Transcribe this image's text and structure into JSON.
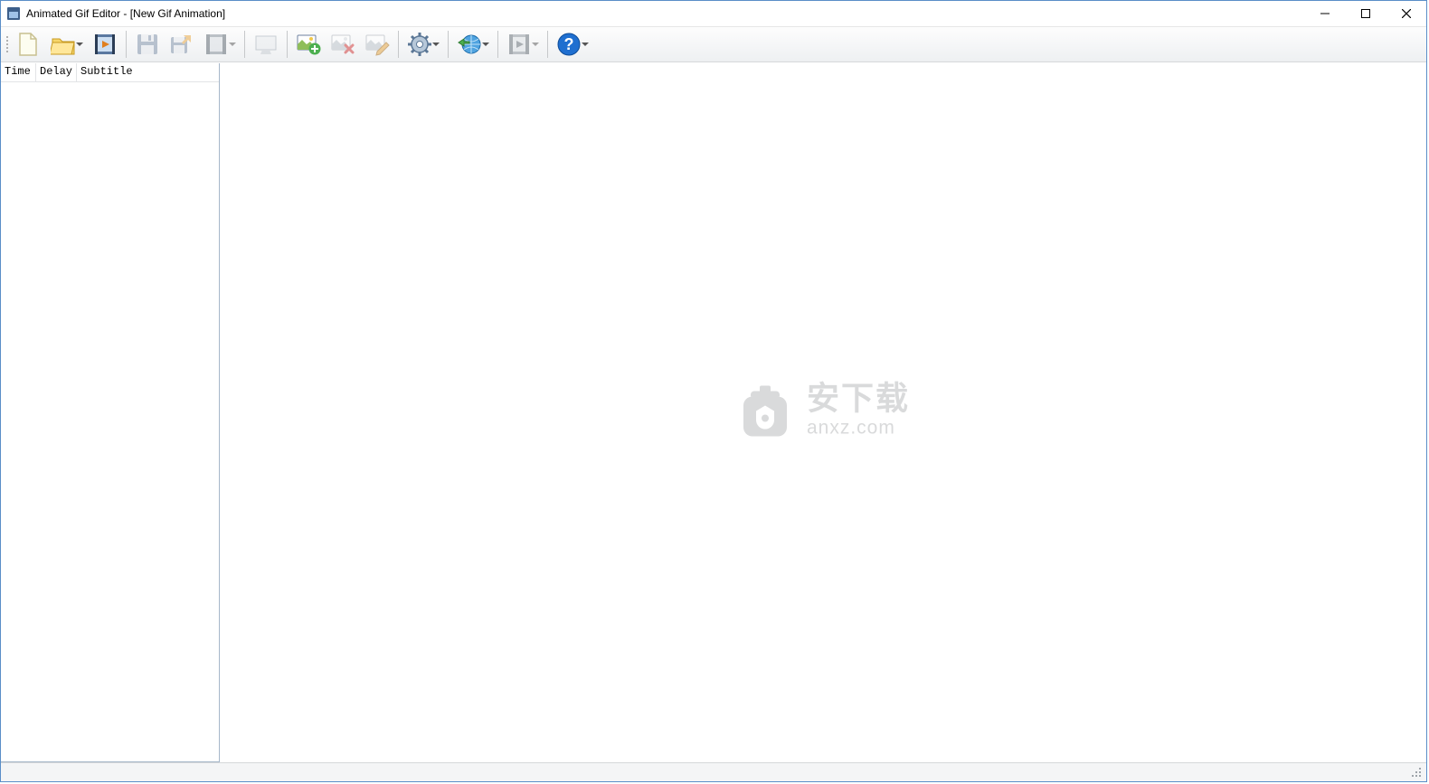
{
  "window": {
    "title": "Animated Gif Editor - [New Gif Animation]"
  },
  "toolbar": {
    "buttons": [
      {
        "id": "new",
        "name": "new-button",
        "icon": "new-file-icon",
        "enabled": true,
        "dropdown": false
      },
      {
        "id": "open",
        "name": "open-button",
        "icon": "folder-open-icon",
        "enabled": true,
        "dropdown": true
      },
      {
        "id": "import",
        "name": "import-video-button",
        "icon": "film-import-icon",
        "enabled": true,
        "dropdown": false
      },
      {
        "sep": true
      },
      {
        "id": "save",
        "name": "save-button",
        "icon": "save-icon",
        "enabled": false,
        "dropdown": false
      },
      {
        "id": "saveas",
        "name": "save-as-button",
        "icon": "save-as-icon",
        "enabled": false,
        "dropdown": false
      },
      {
        "id": "export",
        "name": "export-video-button",
        "icon": "film-export-icon",
        "enabled": false,
        "dropdown": true
      },
      {
        "sep": true
      },
      {
        "id": "preview",
        "name": "preview-button",
        "icon": "preview-icon",
        "enabled": false,
        "dropdown": false
      },
      {
        "sep": true
      },
      {
        "id": "addframe",
        "name": "add-frame-button",
        "icon": "image-add-icon",
        "enabled": true,
        "dropdown": false
      },
      {
        "id": "delframe",
        "name": "delete-frame-button",
        "icon": "image-delete-icon",
        "enabled": false,
        "dropdown": false
      },
      {
        "id": "editframe",
        "name": "edit-frame-button",
        "icon": "image-edit-icon",
        "enabled": false,
        "dropdown": false
      },
      {
        "sep": true
      },
      {
        "id": "settings",
        "name": "settings-button",
        "icon": "gear-icon",
        "enabled": true,
        "dropdown": true
      },
      {
        "sep": true
      },
      {
        "id": "web",
        "name": "web-button",
        "icon": "globe-arrow-icon",
        "enabled": true,
        "dropdown": true
      },
      {
        "sep": true
      },
      {
        "id": "play",
        "name": "play-button",
        "icon": "film-play-icon",
        "enabled": false,
        "dropdown": true
      },
      {
        "sep": true
      },
      {
        "id": "help",
        "name": "help-button",
        "icon": "help-icon",
        "enabled": true,
        "dropdown": true
      }
    ]
  },
  "sidebar": {
    "columns": {
      "time": "Time",
      "delay": "Delay",
      "subtitle": "Subtitle"
    }
  },
  "watermark": {
    "cn": "安下载",
    "domain": "anxz.com"
  }
}
